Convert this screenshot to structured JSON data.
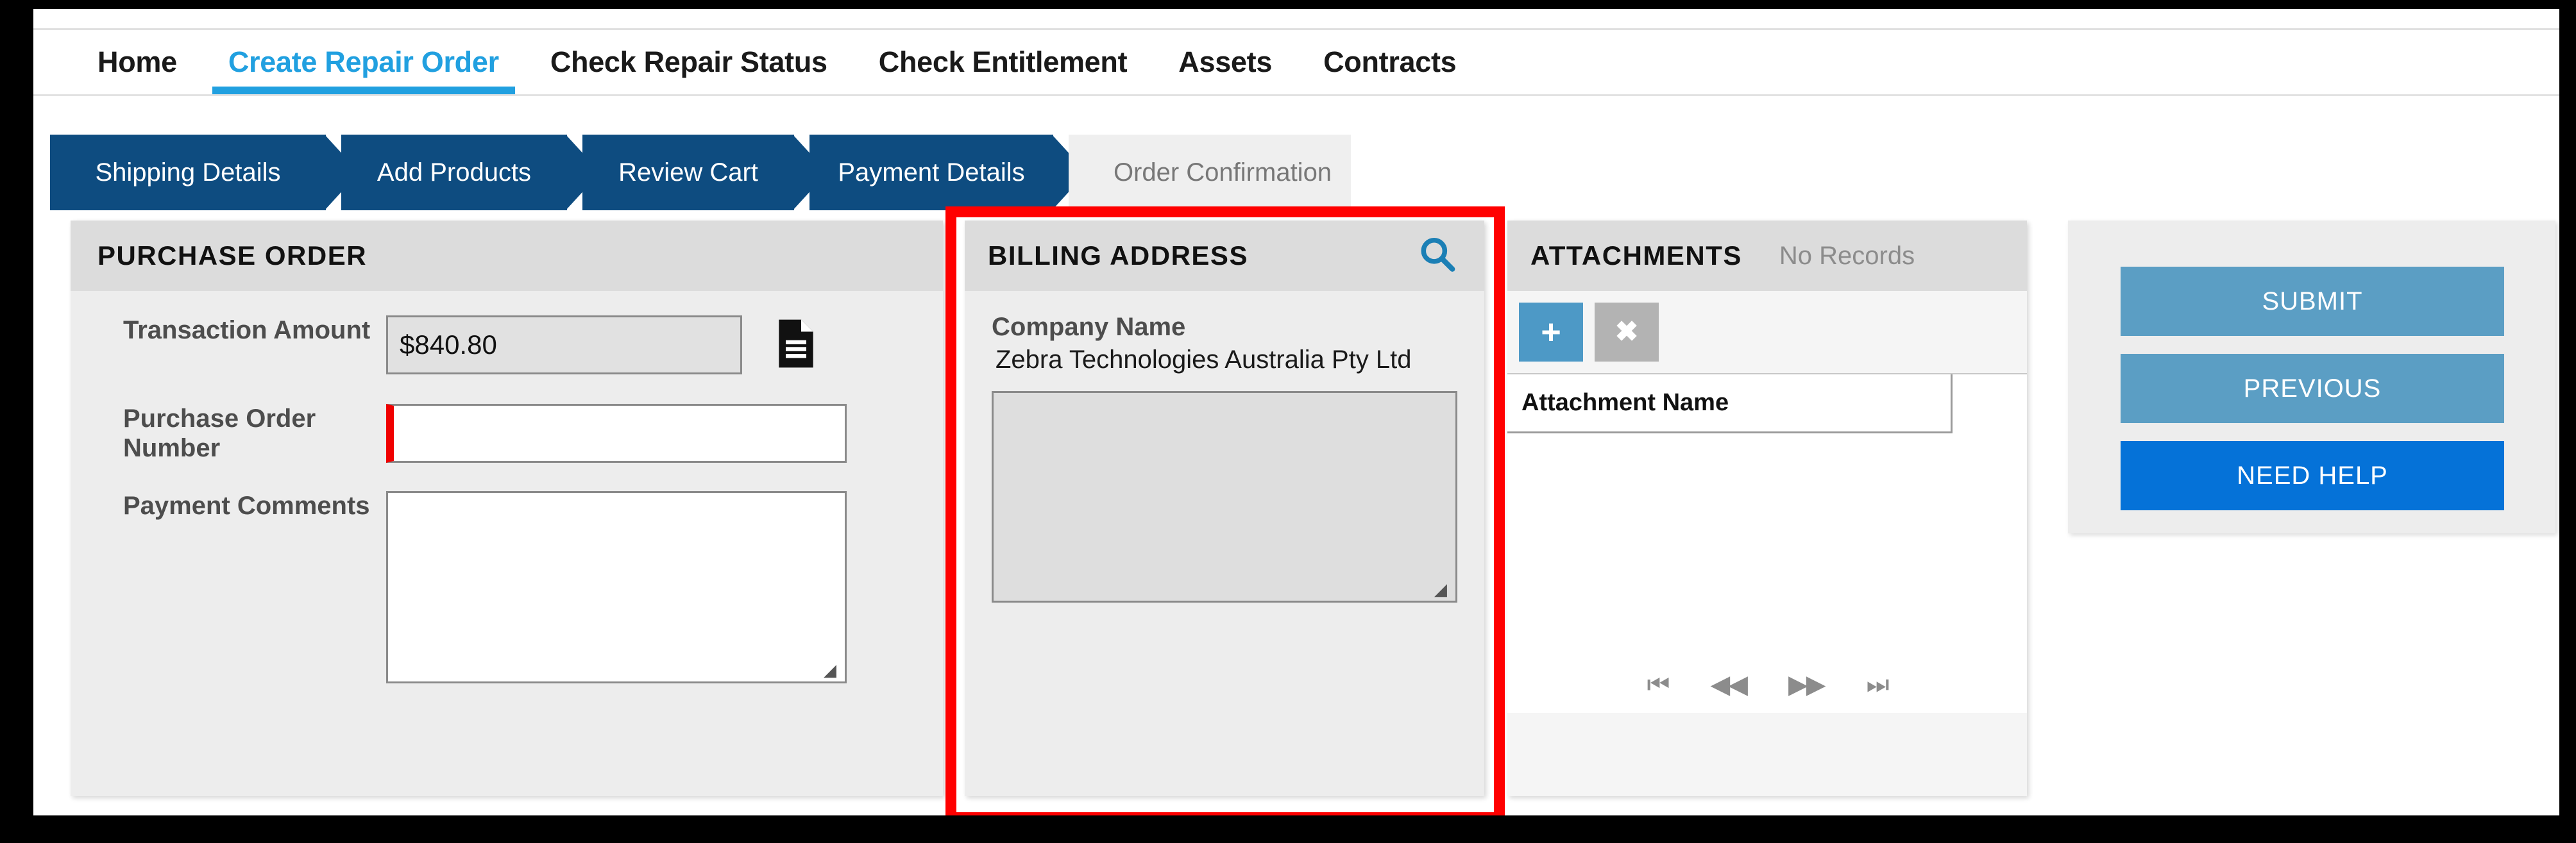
{
  "nav": {
    "items": [
      {
        "label": "Home",
        "active": false
      },
      {
        "label": "Create Repair Order",
        "active": true
      },
      {
        "label": "Check Repair Status",
        "active": false
      },
      {
        "label": "Check Entitlement",
        "active": false
      },
      {
        "label": "Assets",
        "active": false
      },
      {
        "label": "Contracts",
        "active": false
      }
    ]
  },
  "steps": [
    {
      "label": "Shipping Details",
      "state": "complete"
    },
    {
      "label": "Add Products",
      "state": "complete"
    },
    {
      "label": "Review Cart",
      "state": "complete"
    },
    {
      "label": "Payment Details",
      "state": "current"
    },
    {
      "label": "Order Confirmation",
      "state": "pending"
    }
  ],
  "purchase_order": {
    "title": "PURCHASE ORDER",
    "transaction_amount_label": "Transaction Amount",
    "transaction_amount_value": "$840.80",
    "document_icon": "document-icon",
    "po_number_label": "Purchase Order Number",
    "po_number_value": "",
    "po_number_placeholder": "",
    "payment_comments_label": "Payment Comments",
    "payment_comments_value": "",
    "payment_comments_placeholder": ""
  },
  "billing_address": {
    "title": "BILLING ADDRESS",
    "search_icon": "search-icon",
    "company_name_label": "Company Name",
    "company_name_value": "Zebra Technologies Australia Pty Ltd",
    "address_value": "",
    "address_placeholder": ""
  },
  "attachments": {
    "title": "ATTACHMENTS",
    "status": "No Records",
    "add_label": "+",
    "delete_label": "✖",
    "columns": [
      "Attachment Name"
    ],
    "rows": [],
    "pager": [
      {
        "name": "first-page-button",
        "glyph": "⏮"
      },
      {
        "name": "previous-page-button",
        "glyph": "◀◀"
      },
      {
        "name": "next-page-button",
        "glyph": "▶▶"
      },
      {
        "name": "last-page-button",
        "glyph": "⏭"
      }
    ]
  },
  "actions": {
    "submit_label": "SUBMIT",
    "previous_label": "PREVIOUS",
    "help_label": "NEED HELP"
  },
  "colors": {
    "accent_blue": "#21a0e0",
    "step_blue": "#0e4c80",
    "button_blue": "#5b9ec4",
    "help_blue": "#0572d8",
    "highlight_red": "#ff0000",
    "required_red": "#f00000"
  }
}
